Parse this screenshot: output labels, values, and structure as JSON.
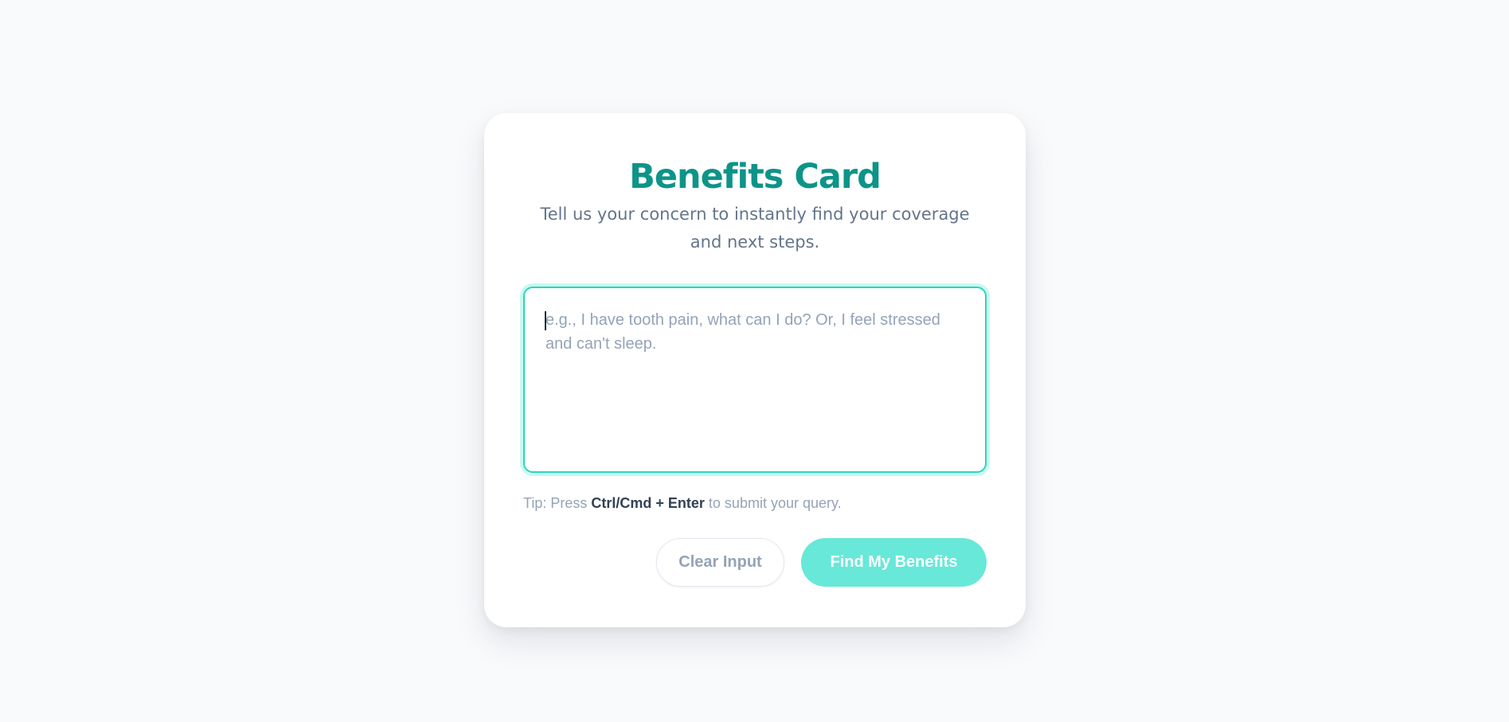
{
  "card": {
    "title": "Benefits Card",
    "subtitle": "Tell us your concern to instantly find your coverage and next steps."
  },
  "query": {
    "value": "",
    "placeholder": "e.g., I have tooth pain, what can I do? Or, I feel stressed and can't sleep."
  },
  "tip": {
    "prefix": "Tip: Press",
    "shortcut": "Ctrl/Cmd + Enter",
    "suffix": "to submit your query."
  },
  "actions": {
    "clear_label": "Clear Input",
    "submit_label": "Find My Benefits"
  },
  "colors": {
    "accent": "#0d9488",
    "focus_border": "#2dd4bf",
    "submit_bg": "#67e8d9",
    "page_bg": "#f8fafc"
  }
}
